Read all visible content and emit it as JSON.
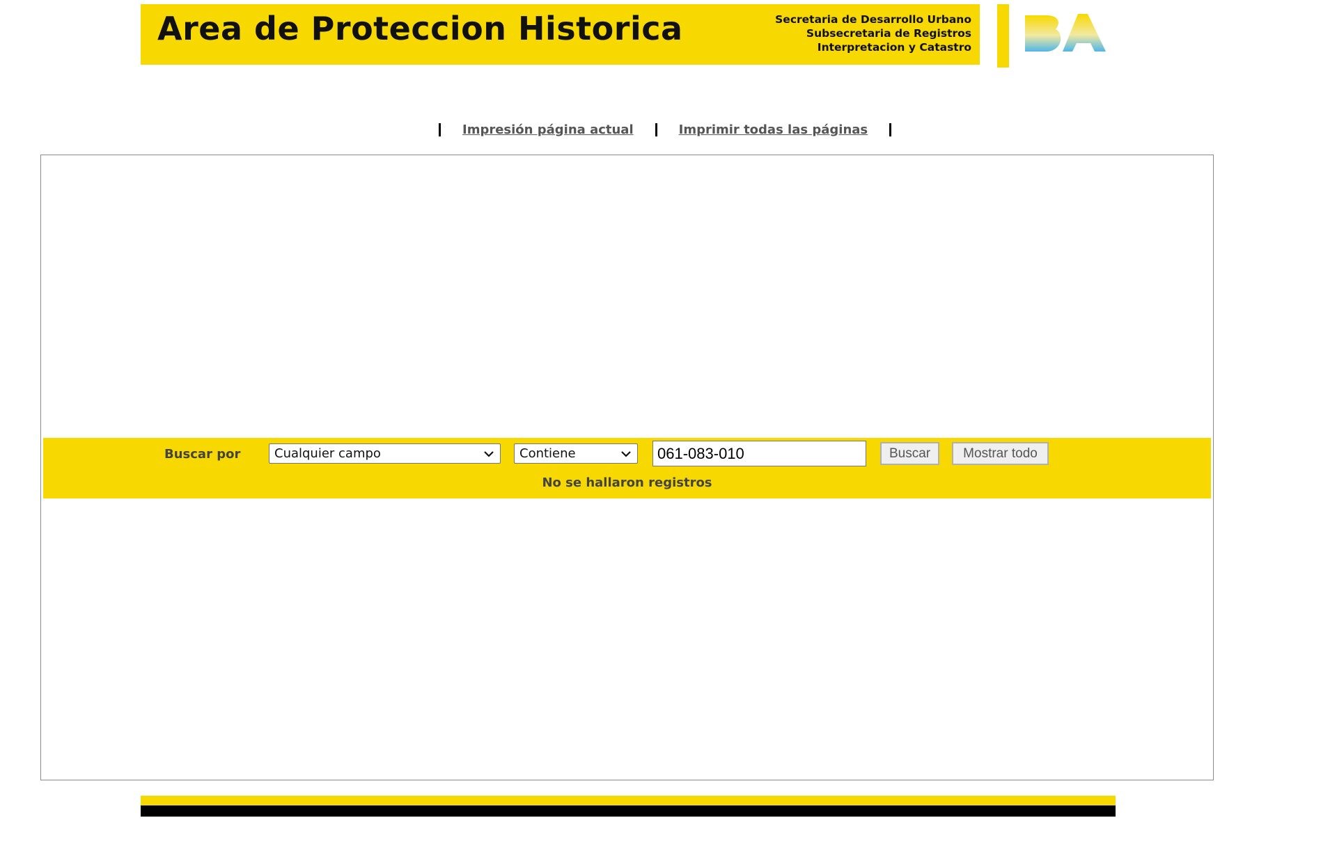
{
  "header": {
    "title": "Area de Proteccion Historica",
    "subtitles": [
      "Secretaria de Desarrollo Urbano",
      "Subsecretaria de Registros",
      "Interpretacion y Catastro"
    ],
    "logo": "ba-logo",
    "brand_color": "#f7d800"
  },
  "print_links": {
    "current_page": "Impresión página actual",
    "all_pages": "Imprimir todas las páginas"
  },
  "search": {
    "label": "Buscar por",
    "field_select": {
      "selected": "Cualquier campo"
    },
    "mode_select": {
      "selected": "Contiene"
    },
    "query_value": "061-083-010",
    "search_button": "Buscar",
    "show_all_button": "Mostrar todo",
    "status": "No se hallaron registros"
  }
}
